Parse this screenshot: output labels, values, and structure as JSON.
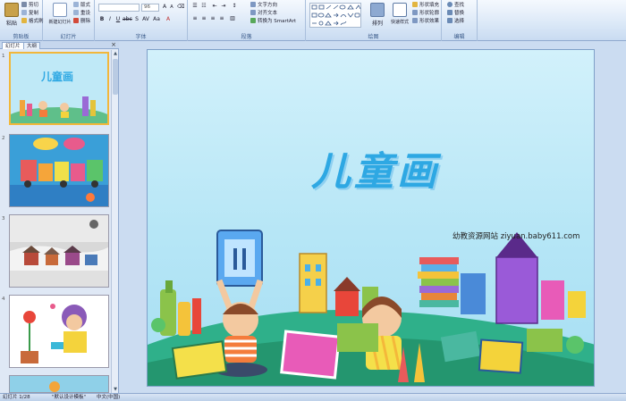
{
  "ribbon": {
    "clipboard": {
      "label": "剪贴板",
      "paste": "粘贴",
      "cut": "剪切",
      "copy": "复制",
      "format_painter": "格式刷"
    },
    "slides": {
      "label": "幻灯片",
      "new_slide": "新建幻灯片",
      "layout": "版式",
      "reset": "重设",
      "delete": "删除"
    },
    "font": {
      "label": "字体",
      "font_name": "",
      "font_size": "96"
    },
    "paragraph": {
      "label": "段落",
      "text_direction": "文字方向",
      "align_text": "对齐文本",
      "smartart": "转换为 SmartArt"
    },
    "drawing": {
      "label": "绘图",
      "arrange": "排列",
      "quick_styles": "快速样式",
      "fill": "形状填充",
      "outline": "形状轮廓",
      "effects": "形状效果"
    },
    "editing": {
      "label": "编辑",
      "find": "查找",
      "replace": "替换",
      "select": "选择"
    }
  },
  "panel": {
    "tabs": [
      "幻灯片",
      "大纲"
    ],
    "close": "×",
    "slide_numbers": [
      "1",
      "2",
      "3",
      "4"
    ]
  },
  "slide": {
    "title": "儿童画",
    "watermark": "幼教资源网站  ziyuan.baby611.com"
  },
  "status": {
    "slide_info": "幻灯片 1/28",
    "theme": "\"默认设计模板\"",
    "language": "中文(中国)"
  },
  "colors": {
    "title": "#2ea8e3",
    "slide_bg": "#b6e6f6",
    "ribbon_bg": "#dbe8f7",
    "selected_thumb_border": "#f2b73a"
  }
}
